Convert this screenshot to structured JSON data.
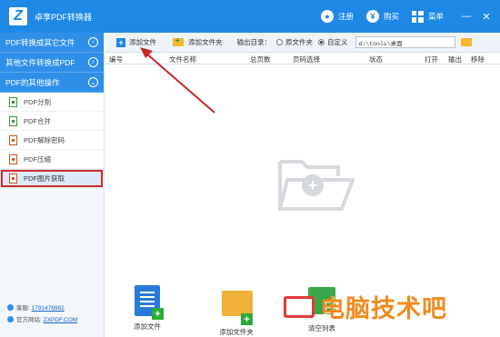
{
  "titlebar": {
    "app_title": "卓享PDF转换器",
    "register": "注册",
    "buy": "购买",
    "menu": "菜单",
    "minimize": "—",
    "close": "✕"
  },
  "sidebar": {
    "categories": [
      {
        "label": "PDF转换成其它文件",
        "arrow": "›"
      },
      {
        "label": "其他文件转换成PDF",
        "arrow": "›"
      },
      {
        "label": "PDF的其他操作",
        "arrow": "⌄"
      }
    ],
    "items": [
      {
        "label": "PDF分割"
      },
      {
        "label": "PDF合并"
      },
      {
        "label": "PDF解除密码"
      },
      {
        "label": "PDF压缩"
      },
      {
        "label": "PDF图片获取"
      }
    ],
    "qq_label": "客服:",
    "qq_value": "1791476982",
    "site_label": "官方网站:",
    "site_value": "ZXPDF.COM"
  },
  "toolbar": {
    "add_file": "添加文件",
    "add_folder": "添加文件夹",
    "output_dir": "输出目录：",
    "original_folder": "原文件夹",
    "custom": "自定义",
    "path": "d:\\tools\\桌面"
  },
  "table": {
    "headers": [
      "编号",
      "文件名称",
      "总页数",
      "页码选择",
      "状态",
      "打开",
      "输出",
      "移除"
    ]
  },
  "bottom": {
    "add_file": "添加文件",
    "add_folder": "添加文件夹",
    "clear_list": "清空列表"
  },
  "watermark": {
    "text": "电脑技术吧"
  },
  "colors": {
    "brand": "#1e88e5",
    "highlight": "#d42a2a",
    "watermark": "#f28a1e"
  }
}
